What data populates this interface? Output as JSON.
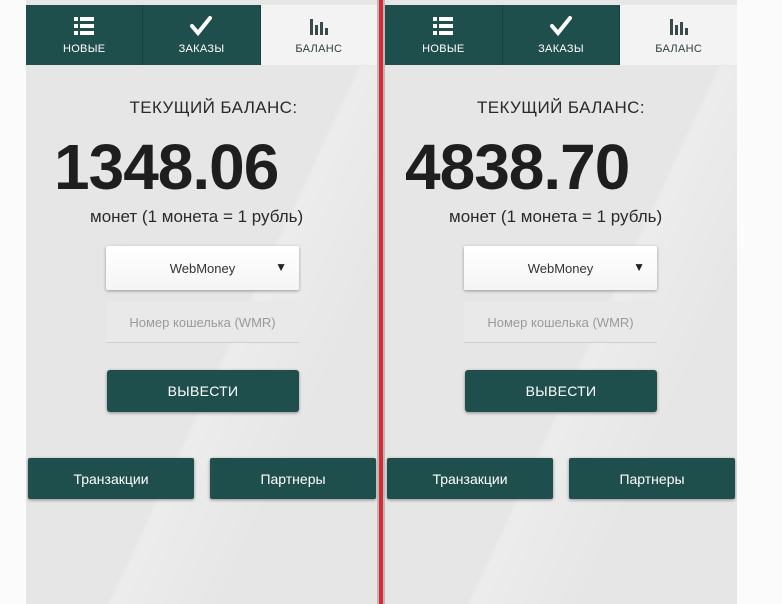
{
  "screens": [
    {
      "tabs": [
        {
          "label": "НОВЫЕ",
          "icon": "list-icon"
        },
        {
          "label": "ЗАКАЗЫ",
          "icon": "checkmark-icon"
        },
        {
          "label": "БАЛАНС",
          "icon": "bar-chart-icon"
        }
      ],
      "active_tab": 2,
      "balance_title": "ТЕКУЩИЙ БАЛАНС:",
      "balance_amount": "1348.06",
      "coins_note": "монет (1 монета = 1 рубль)",
      "payment_method": "WebMoney",
      "wallet_placeholder": "Номер кошелька (WMR)",
      "withdraw_label": "ВЫВЕСТИ",
      "transactions_label": "Транзакции",
      "partners_label": "Партнеры"
    },
    {
      "tabs": [
        {
          "label": "НОВЫЕ",
          "icon": "list-icon"
        },
        {
          "label": "ЗАКАЗЫ",
          "icon": "checkmark-icon"
        },
        {
          "label": "БАЛАНС",
          "icon": "bar-chart-icon"
        }
      ],
      "active_tab": 2,
      "balance_title": "ТЕКУЩИЙ БАЛАНС:",
      "balance_amount": "4838.70",
      "coins_note": "монет (1 монета = 1 рубль)",
      "payment_method": "WebMoney",
      "wallet_placeholder": "Номер кошелька (WMR)",
      "withdraw_label": "ВЫВЕСТИ",
      "transactions_label": "Транзакции",
      "partners_label": "Партнеры"
    }
  ],
  "colors": {
    "tab_bg": "#1f4f4c",
    "button_bg": "#1f4f4c",
    "divider": "#d82a33",
    "screen_bg": "#e6e6e6"
  }
}
